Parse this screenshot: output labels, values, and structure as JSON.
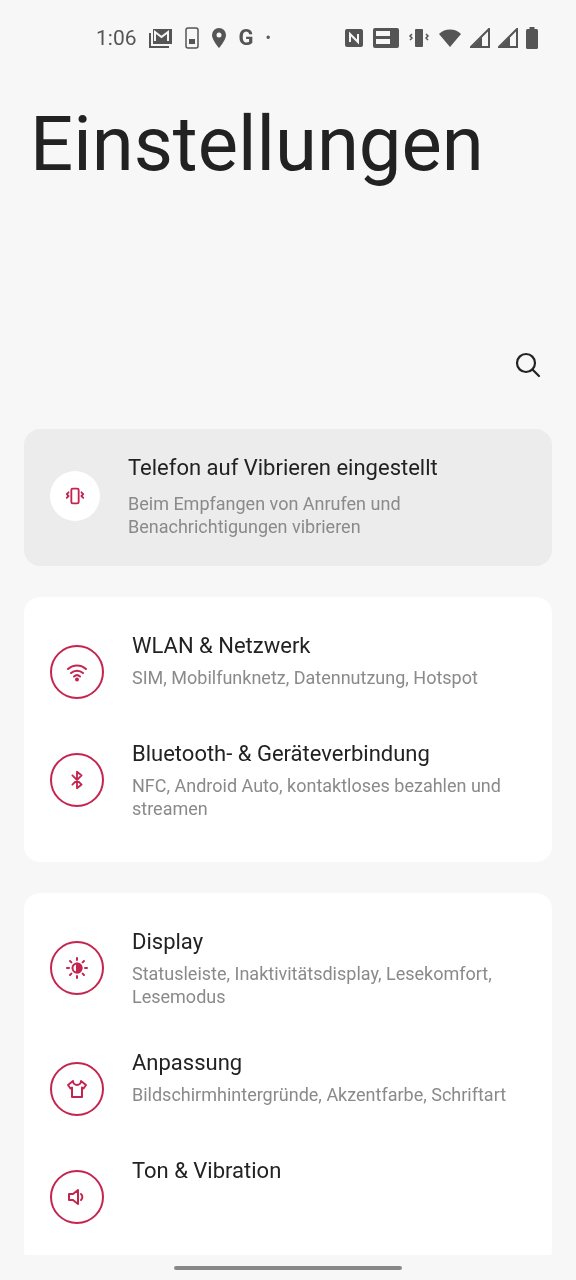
{
  "status_bar": {
    "time": "1:06",
    "google": "G",
    "dot": "•"
  },
  "title": "Einstellungen",
  "suggestion": {
    "kind": "vibrate",
    "title": "Telefon auf Vibrieren eingestellt",
    "subtitle": "Beim Empfangen von Anrufen und Benachrichtigungen vibrieren"
  },
  "groups": [
    {
      "items": [
        {
          "kind": "wifi",
          "title": "WLAN & Netzwerk",
          "subtitle": "SIM, Mobilfunknetz, Datennutzung, Hotspot"
        },
        {
          "kind": "bluetooth",
          "title": "Bluetooth- & Geräteverbindung",
          "subtitle": "NFC, Android Auto, kontaktloses bezahlen und streamen"
        }
      ]
    },
    {
      "items": [
        {
          "kind": "display",
          "title": "Display",
          "subtitle": "Statusleiste, Inaktivitätsdisplay, Lesekomfort, Lesemodus"
        },
        {
          "kind": "shirt",
          "title": "Anpassung",
          "subtitle": "Bildschirmhintergründe, Akzentfarbe, Schriftart"
        },
        {
          "kind": "sound",
          "title": "Ton & Vibration"
        }
      ]
    }
  ]
}
